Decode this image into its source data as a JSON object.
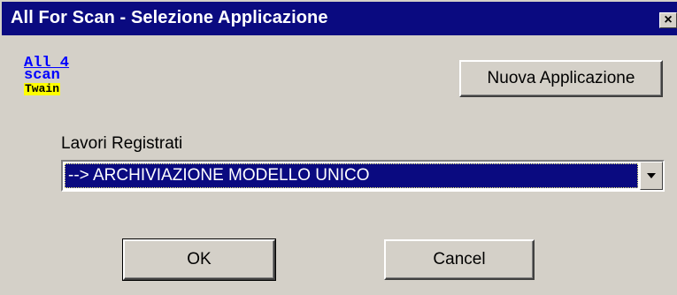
{
  "window": {
    "title": "All For Scan  - Selezione Applicazione",
    "close_glyph": "×"
  },
  "logo": {
    "line1": "All 4",
    "line2": "scan",
    "line3": "Twain"
  },
  "buttons": {
    "new_app": "Nuova Applicazione",
    "ok": "OK",
    "cancel": "Cancel"
  },
  "jobs": {
    "label": "Lavori Registrati",
    "selected": "--> ARCHIVIAZIONE MODELLO UNICO"
  },
  "colors": {
    "title_bar": "#0a0a80",
    "face": "#d4d0c8",
    "logo_blue": "#0000ff",
    "logo_yellow": "#ffff00"
  },
  "icons": {
    "close": "close-icon",
    "dropdown": "chevron-down-icon"
  }
}
